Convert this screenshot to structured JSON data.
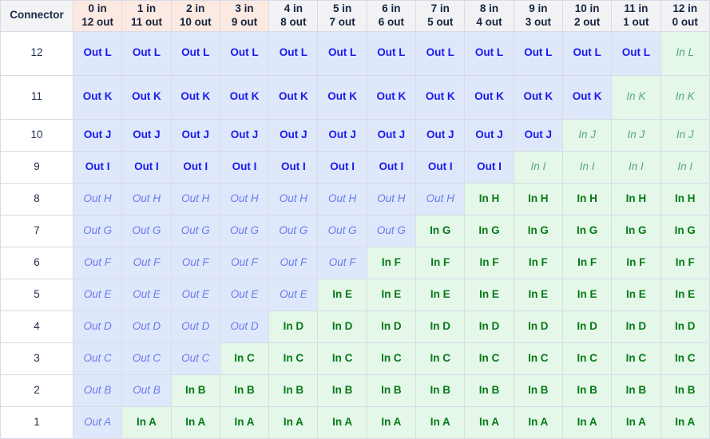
{
  "table": {
    "corner_label": "Connector",
    "columns": [
      {
        "in": "0 in",
        "out": "12 out",
        "header_tone": "pink"
      },
      {
        "in": "1 in",
        "out": "11 out",
        "header_tone": "pink"
      },
      {
        "in": "2 in",
        "out": "10 out",
        "header_tone": "pink"
      },
      {
        "in": "3 in",
        "out": "9 out",
        "header_tone": "pink"
      },
      {
        "in": "4 in",
        "out": "8 out",
        "header_tone": "gray"
      },
      {
        "in": "5 in",
        "out": "7 out",
        "header_tone": "gray"
      },
      {
        "in": "6 in",
        "out": "6 out",
        "header_tone": "gray"
      },
      {
        "in": "7 in",
        "out": "5 out",
        "header_tone": "gray"
      },
      {
        "in": "8 in",
        "out": "4 out",
        "header_tone": "gray"
      },
      {
        "in": "9 in",
        "out": "3 out",
        "header_tone": "gray"
      },
      {
        "in": "10 in",
        "out": "2 out",
        "header_tone": "gray"
      },
      {
        "in": "11 in",
        "out": "1 out",
        "header_tone": "gray"
      },
      {
        "in": "12 in",
        "out": "0 out",
        "header_tone": "gray"
      }
    ],
    "rows": [
      {
        "connector": "12",
        "letter": "L",
        "out_count": 12,
        "emphasis": "out",
        "height": "tall",
        "cells": [
          "Out L",
          "Out L",
          "Out L",
          "Out L",
          "Out L",
          "Out L",
          "Out L",
          "Out L",
          "Out L",
          "Out L",
          "Out L",
          "Out L",
          "In L"
        ]
      },
      {
        "connector": "11",
        "letter": "K",
        "out_count": 11,
        "emphasis": "out",
        "height": "tall",
        "cells": [
          "Out K",
          "Out K",
          "Out K",
          "Out K",
          "Out K",
          "Out K",
          "Out K",
          "Out K",
          "Out K",
          "Out K",
          "Out K",
          "In K",
          "In K"
        ]
      },
      {
        "connector": "10",
        "letter": "J",
        "out_count": 10,
        "emphasis": "out",
        "height": "short",
        "cells": [
          "Out J",
          "Out J",
          "Out J",
          "Out J",
          "Out J",
          "Out J",
          "Out J",
          "Out J",
          "Out J",
          "Out J",
          "In J",
          "In J",
          "In J"
        ]
      },
      {
        "connector": "9",
        "letter": "I",
        "out_count": 9,
        "emphasis": "out",
        "height": "short",
        "cells": [
          "Out I",
          "Out I",
          "Out I",
          "Out I",
          "Out I",
          "Out I",
          "Out I",
          "Out I",
          "Out I",
          "In I",
          "In I",
          "In I",
          "In I"
        ]
      },
      {
        "connector": "8",
        "letter": "H",
        "out_count": 8,
        "emphasis": "in",
        "height": "short",
        "cells": [
          "Out H",
          "Out H",
          "Out H",
          "Out H",
          "Out H",
          "Out H",
          "Out H",
          "Out H",
          "In H",
          "In H",
          "In H",
          "In H",
          "In H"
        ]
      },
      {
        "connector": "7",
        "letter": "G",
        "out_count": 7,
        "emphasis": "in",
        "height": "short",
        "cells": [
          "Out G",
          "Out G",
          "Out G",
          "Out G",
          "Out G",
          "Out G",
          "Out G",
          "In G",
          "In G",
          "In G",
          "In G",
          "In G",
          "In G"
        ]
      },
      {
        "connector": "6",
        "letter": "F",
        "out_count": 6,
        "emphasis": "in",
        "height": "short",
        "cells": [
          "Out F",
          "Out F",
          "Out F",
          "Out F",
          "Out F",
          "Out F",
          "In F",
          "In F",
          "In F",
          "In F",
          "In F",
          "In F",
          "In F"
        ]
      },
      {
        "connector": "5",
        "letter": "E",
        "out_count": 5,
        "emphasis": "in",
        "height": "short",
        "cells": [
          "Out E",
          "Out E",
          "Out E",
          "Out E",
          "Out E",
          "In E",
          "In E",
          "In E",
          "In E",
          "In E",
          "In E",
          "In E",
          "In E"
        ]
      },
      {
        "connector": "4",
        "letter": "D",
        "out_count": 4,
        "emphasis": "in",
        "height": "short",
        "cells": [
          "Out D",
          "Out D",
          "Out D",
          "Out D",
          "In D",
          "In D",
          "In D",
          "In D",
          "In D",
          "In D",
          "In D",
          "In D",
          "In D"
        ]
      },
      {
        "connector": "3",
        "letter": "C",
        "out_count": 3,
        "emphasis": "in",
        "height": "short",
        "cells": [
          "Out C",
          "Out C",
          "Out C",
          "In C",
          "In C",
          "In C",
          "In C",
          "In C",
          "In C",
          "In C",
          "In C",
          "In C",
          "In C"
        ]
      },
      {
        "connector": "2",
        "letter": "B",
        "out_count": 2,
        "emphasis": "in",
        "height": "short",
        "cells": [
          "Out B",
          "Out B",
          "In B",
          "In B",
          "In B",
          "In B",
          "In B",
          "In B",
          "In B",
          "In B",
          "In B",
          "In B",
          "In B"
        ]
      },
      {
        "connector": "1",
        "letter": "A",
        "out_count": 1,
        "emphasis": "in",
        "height": "short",
        "cells": [
          "Out A",
          "In A",
          "In A",
          "In A",
          "In A",
          "In A",
          "In A",
          "In A",
          "In A",
          "In A",
          "In A",
          "In A",
          "In A"
        ]
      }
    ]
  },
  "colors": {
    "header_pink": "#fce9e1",
    "header_gray": "#f2f2f4",
    "corner_gray": "#f4f4f6",
    "out_bg": "#dfe8fb",
    "in_bg": "#e4f7e9",
    "out_text_strong": "#1a1aee",
    "out_text_faint": "#6a7af0",
    "in_text_strong": "#067a17",
    "in_text_faint": "#5aa87a",
    "grid_line": "#d8dbe6",
    "row_label_text": "#20304d"
  }
}
